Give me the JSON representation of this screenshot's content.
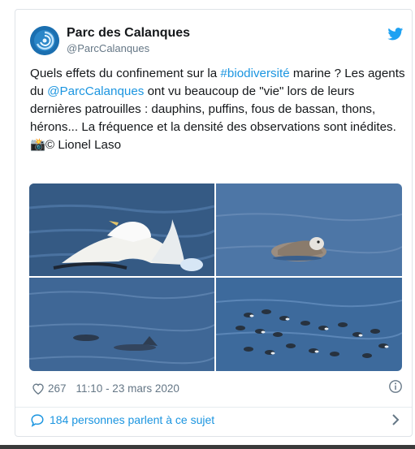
{
  "account": {
    "name": "Parc des Calanques",
    "handle": "@ParcCalanques"
  },
  "tweet": {
    "text_1": "Quels effets du confinement sur la ",
    "hashtag": "#biodiversité",
    "text_2": " marine ? Les agents du ",
    "mention": "@ParcCalanques",
    "text_3": " ont vu beaucoup de \"vie\" lors de leurs dernières patrouilles : dauphins, puffins, fous de bassan, thons, hérons... La fréquence et la densité des observations sont inédites.",
    "credit_emoji": "📸",
    "credit": "© Lionel Laso"
  },
  "meta": {
    "likes": "267",
    "timestamp": "11:10 - 23 mars 2020"
  },
  "footer": {
    "conversation": "184 personnes parlent à ce sujet"
  },
  "icons": {
    "brand": "twitter-bird-icon",
    "like": "heart-icon",
    "info": "info-icon",
    "reply": "speech-bubble-icon",
    "more": "chevron-right-icon"
  },
  "colors": {
    "link": "#1b95e0",
    "twitter_blue": "#1da1f2",
    "text": "#14171a",
    "muted": "#657786"
  }
}
